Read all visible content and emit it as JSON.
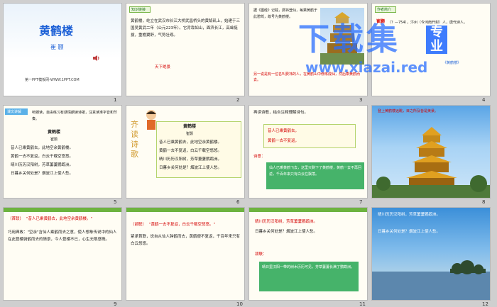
{
  "slides": [
    {
      "num": "1",
      "title": "黄鹤楼",
      "author": "崔 颢",
      "footer": "第一PPT模板网-WWW.1PPT.COM"
    },
    {
      "num": "2",
      "tag": "知识链接",
      "body": "黄鹤楼，屹立在武汉市长江大桥武昌桥头的黄鹄矶上，始建于三国吴黄武二年（公元223年）。它背靠如山，面滨长江，高耸挺拔，重檐翼舒，气势壮观。",
      "hl": "天下绝景"
    },
    {
      "num": "3",
      "body": "据《图经》记载，费祎登仙，每乘黄鹤于此憩驾，故号为黄鹤楼。",
      "body2": "另一说是有一位名叫费祎的人，在黄鹤山中修炼成仙，然后乘黄鹤而去。"
    },
    {
      "num": "4",
      "tag": "作者简介",
      "name": "崔颢",
      "body": "（？—754），汴州（今河南开封）人，唐代诗人。",
      "hl": "《黄鹤楼》"
    },
    {
      "num": "5",
      "tag": "课文讲解",
      "hint": "听朗读，自由练习有感情朗读诗歌，注意读准字音和节奏。",
      "title": "黄鹤楼",
      "author": "崔颢",
      "lines": [
        "昔人已乘黄鹤去，此地空余黄鹤楼。",
        "黄鹤一去不复返，白云千载空悠悠。",
        "晴川历历汉阳树，芳草萋萋鹦鹉洲。",
        "日暮乡关何处是？烟波江上使人愁。"
      ]
    },
    {
      "num": "6",
      "side": "齐读诗歌",
      "title": "黄鹤楼",
      "author": "崔颢",
      "lines": [
        "昔人已乘黄鹤去，此地空余黄鹤楼。",
        "黄鹤一去不复返，白云千载空悠悠。",
        "晴川历历汉阳树，芳草萋萋鹦鹉洲。",
        "日暮乡关何处是？烟波江上使人愁。"
      ]
    },
    {
      "num": "7",
      "hint": "再读诗歌，结合注释理解诗句。",
      "l1": "昔人已乘黄鹤去，",
      "l2": "黄鹤一去不复返，",
      "label": "诗意：",
      "body": "仙人已乘黄鹤飞去，这里只剩下了黄鹤楼，黄鹤一去不再回返，千百年来只有白云在飘荡。"
    },
    {
      "num": "8",
      "caption": "登上黄鹤楼远眺，目之所及皆是美景。"
    },
    {
      "num": "9",
      "tag": "（首联）",
      "quote": "\"昔人已乘黄鹤去，此地空余黄鹤楼。\"",
      "body": "巧用典故：\"空余\"含仙人乘鹤而去之意，使人想象传说中的仙人在此登楼骑鹤而去的情景，今人登楼不已，心生无限感慨。"
    },
    {
      "num": "10",
      "tag": "（颔联）",
      "quote": "\"黄鹤一去不复返，白云千载空悠悠。\"",
      "body": "紧承首联，说自从仙人跨鹤而去，黄鹤便不复返，千百年来只有白云悠悠。"
    },
    {
      "num": "11",
      "l1": "晴川历历汉阳树，芳草萋萋鹦鹉洲。",
      "l2": "日暮乡关何处是？烟波江上使人愁。",
      "label": "颈联：",
      "body": "晴日里汉阳一带的树木历历可见，芳草萋萋长满了鹦鹉洲。"
    },
    {
      "num": "12",
      "l1": "晴川历历汉阳树，芳草萋萋鹦鹉洲。",
      "l2": "日暮乡关何处是？烟波江上使人愁。"
    }
  ],
  "watermark": {
    "line1": "下载集",
    "line2": "专业",
    "url": "www.xiazai.red"
  },
  "colors": {
    "accent": "#1b5fd6",
    "red": "#d40000",
    "green": "#6db33f"
  }
}
